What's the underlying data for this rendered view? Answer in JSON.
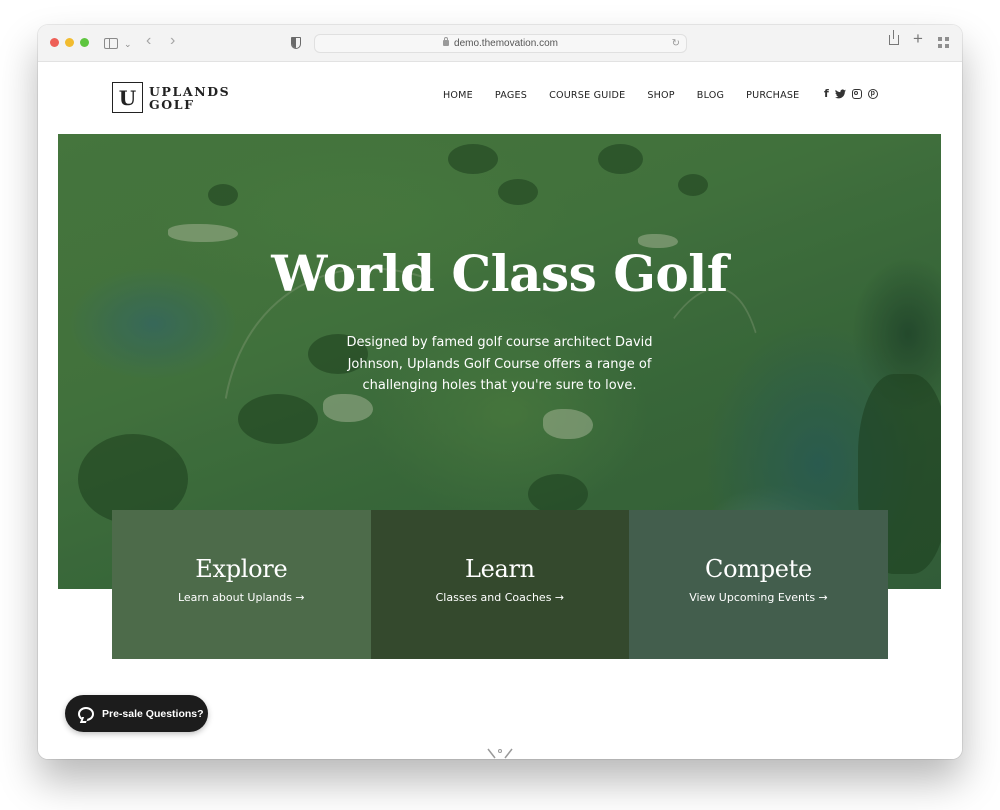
{
  "browser": {
    "url": "demo.themovation.com",
    "icons": [
      "sidebar-icon",
      "chevron-down-icon",
      "back-icon",
      "forward-icon",
      "privacy-shield-icon",
      "lock-icon",
      "reload-icon",
      "share-icon",
      "new-tab-icon",
      "tab-overview-icon"
    ]
  },
  "site": {
    "logo": {
      "letter": "U",
      "line1": "UPLANDS",
      "line2": "GOLF"
    },
    "nav": [
      {
        "label": "HOME"
      },
      {
        "label": "PAGES"
      },
      {
        "label": "COURSE GUIDE"
      },
      {
        "label": "SHOP"
      },
      {
        "label": "BLOG"
      },
      {
        "label": "PURCHASE"
      }
    ],
    "social": {
      "facebook": "f",
      "twitter": "twitter-icon",
      "instagram": "instagram-icon",
      "pinterest": "p"
    },
    "hero": {
      "title": "World Class Golf",
      "subtitle": "Designed by famed golf course architect David Johnson, Uplands Golf Course offers a range of challenging holes that you're sure to love."
    },
    "cards": [
      {
        "title": "Explore",
        "link": "Learn about Uplands →",
        "color": "#4d6b4a"
      },
      {
        "title": "Learn",
        "link": "Classes and Coaches →",
        "color": "#34492d"
      },
      {
        "title": "Compete",
        "link": "View Upcoming Events →",
        "color": "#435e4d"
      }
    ],
    "chat": {
      "label": "Pre-sale Questions?"
    }
  }
}
